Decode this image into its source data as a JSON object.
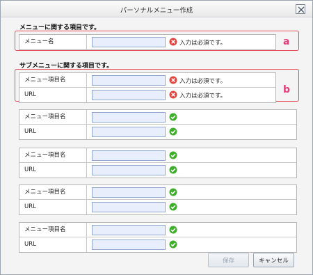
{
  "dialog": {
    "title": "パーソナルメニュー作成"
  },
  "menu_section": {
    "heading": "メニューに関する項目です。",
    "name_label": "メニュー名",
    "name_value": "",
    "status": "error",
    "status_text": "入力は必須です。",
    "callout_letter": "a"
  },
  "submenu_section": {
    "heading": "サブメニューに関する項目です。",
    "callout_letter": "b",
    "groups": [
      {
        "item_label": "メニュー項目名",
        "item_value": "",
        "item_status": "error",
        "item_status_text": "入力は必須です。",
        "url_label": "URL",
        "url_value": "",
        "url_status": "error",
        "url_status_text": "入力は必須です。"
      },
      {
        "item_label": "メニュー項目名",
        "item_value": "",
        "item_status": "ok",
        "url_label": "URL",
        "url_value": "",
        "url_status": "ok"
      },
      {
        "item_label": "メニュー項目名",
        "item_value": "",
        "item_status": "ok",
        "url_label": "URL",
        "url_value": "",
        "url_status": "ok"
      },
      {
        "item_label": "メニュー項目名",
        "item_value": "",
        "item_status": "ok",
        "url_label": "URL",
        "url_value": "",
        "url_status": "ok"
      },
      {
        "item_label": "メニュー項目名",
        "item_value": "",
        "item_status": "ok",
        "url_label": "URL",
        "url_value": "",
        "url_status": "ok"
      }
    ]
  },
  "footer": {
    "save_label": "保存",
    "save_enabled": false,
    "cancel_label": "キャンセル"
  },
  "colors": {
    "error_icon": "#e0463f",
    "ok_icon": "#3fae2a",
    "callout_border": "#e54b55",
    "callout_letter": "#e0407a",
    "input_bg": "#e8eefb"
  },
  "icons": {
    "close": "close-x-icon",
    "error": "error-x-circle-icon",
    "ok": "check-circle-icon"
  }
}
